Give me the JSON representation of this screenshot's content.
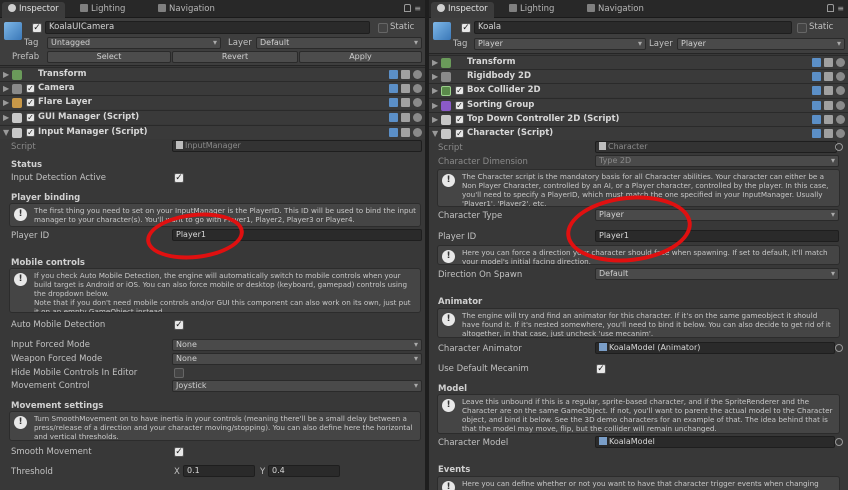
{
  "left": {
    "tabs": [
      "Inspector",
      "Lighting",
      "Navigation"
    ],
    "object_name": "KoalaUICamera",
    "static_label": "Static",
    "tag_label": "Tag",
    "tag_value": "Untagged",
    "layer_label": "Layer",
    "layer_value": "Default",
    "prefab_label": "Prefab",
    "prefab_buttons": [
      "Select",
      "Revert",
      "Apply"
    ],
    "components": [
      "Transform",
      "Camera",
      "Flare Layer",
      "GUI Manager (Script)",
      "Input Manager (Script)"
    ],
    "script_label": "Script",
    "script_value": "InputManager",
    "status_title": "Status",
    "input_detection_label": "Input Detection Active",
    "player_binding_title": "Player binding",
    "player_binding_help": "The first thing you need to set on your InputManager is the PlayerID. This ID will be used to bind the input manager to your character(s). You'll want to go with Player1, Player2, Player3 or Player4.",
    "player_id_label": "Player ID",
    "player_id_value": "Player1",
    "mobile_title": "Mobile controls",
    "mobile_help": "If you check Auto Mobile Detection, the engine will automatically switch to mobile controls when your build target is Android or iOS. You can also force mobile or desktop (keyboard, gamepad) controls using the dropdown below.\nNote that if you don't need mobile controls and/or GUI this component can also work on its own, just put it on an empty GameObject instead.",
    "auto_mobile_label": "Auto Mobile Detection",
    "input_forced_label": "Input Forced Mode",
    "input_forced_value": "None",
    "weapon_forced_label": "Weapon Forced Mode",
    "weapon_forced_value": "None",
    "hide_mobile_label": "Hide Mobile Controls In Editor",
    "movement_control_label": "Movement Control",
    "movement_control_value": "Joystick",
    "movement_settings_title": "Movement settings",
    "movement_help": "Turn SmoothMovement on to have inertia in your controls (meaning there'll be a small delay between a press/release of a direction and your character moving/stopping). You can also define here the horizontal and vertical thresholds.",
    "smooth_movement_label": "Smooth Movement",
    "threshold_label": "Threshold",
    "threshold_x_label": "X",
    "threshold_x": "0.1",
    "threshold_y_label": "Y",
    "threshold_y": "0.4"
  },
  "right": {
    "tabs": [
      "Inspector",
      "Lighting",
      "Navigation"
    ],
    "object_name": "Koala",
    "static_label": "Static",
    "tag_label": "Tag",
    "tag_value": "Player",
    "layer_label": "Layer",
    "layer_value": "Player",
    "components": [
      "Transform",
      "Rigidbody 2D",
      "Box Collider 2D",
      "Sorting Group",
      "Top Down Controller 2D (Script)",
      "Character (Script)"
    ],
    "script_label": "Script",
    "script_value": "Character",
    "char_dimension_label": "Character Dimension",
    "char_dimension_value": "Type 2D",
    "character_help": "The Character script is the mandatory basis for all Character abilities. Your character can either be a Non Player Character, controlled by an AI, or a Player character, controlled by the player. In this case, you'll need to specify a PlayerID, which must match the one specified in your InputManager. Usually 'Player1', 'Player2', etc.",
    "character_type_label": "Character Type",
    "character_type_value": "Player",
    "player_id_label": "Player ID",
    "player_id_value": "Player1",
    "direction_help": "Here you can force a direction your character should face when spawning. If set to default, it'll match your model's initial facing direction.",
    "direction_spawn_label": "Direction On Spawn",
    "direction_spawn_value": "Default",
    "animator_title": "Animator",
    "animator_help": "The engine will try and find an animator for this character. If it's on the same gameobject it should have found it. If it's nested somewhere, you'll need to bind it below. You can also decide to get rid of it altogether, in that case, just uncheck 'use mecanim'.",
    "char_animator_label": "Character Animator",
    "char_animator_value": "KoalaModel (Animator)",
    "use_mecanim_label": "Use Default Mecanim",
    "model_title": "Model",
    "model_help": "Leave this unbound if this is a regular, sprite-based character, and if the SpriteRenderer and the Character are on the same GameObject. If not, you'll want to parent the actual model to the Character object, and bind it below. See the 3D demo characters for an example of that. The idea behind that is that the model may move, flip, but the collider will remain unchanged.",
    "char_model_label": "Character Model",
    "char_model_value": "KoalaModel",
    "events_title": "Events",
    "events_help": "Here you can define whether or not you want to have that character trigger events when changing"
  },
  "colors": {
    "highlight_circle": "#e01010",
    "panel_bg": "#383838"
  }
}
